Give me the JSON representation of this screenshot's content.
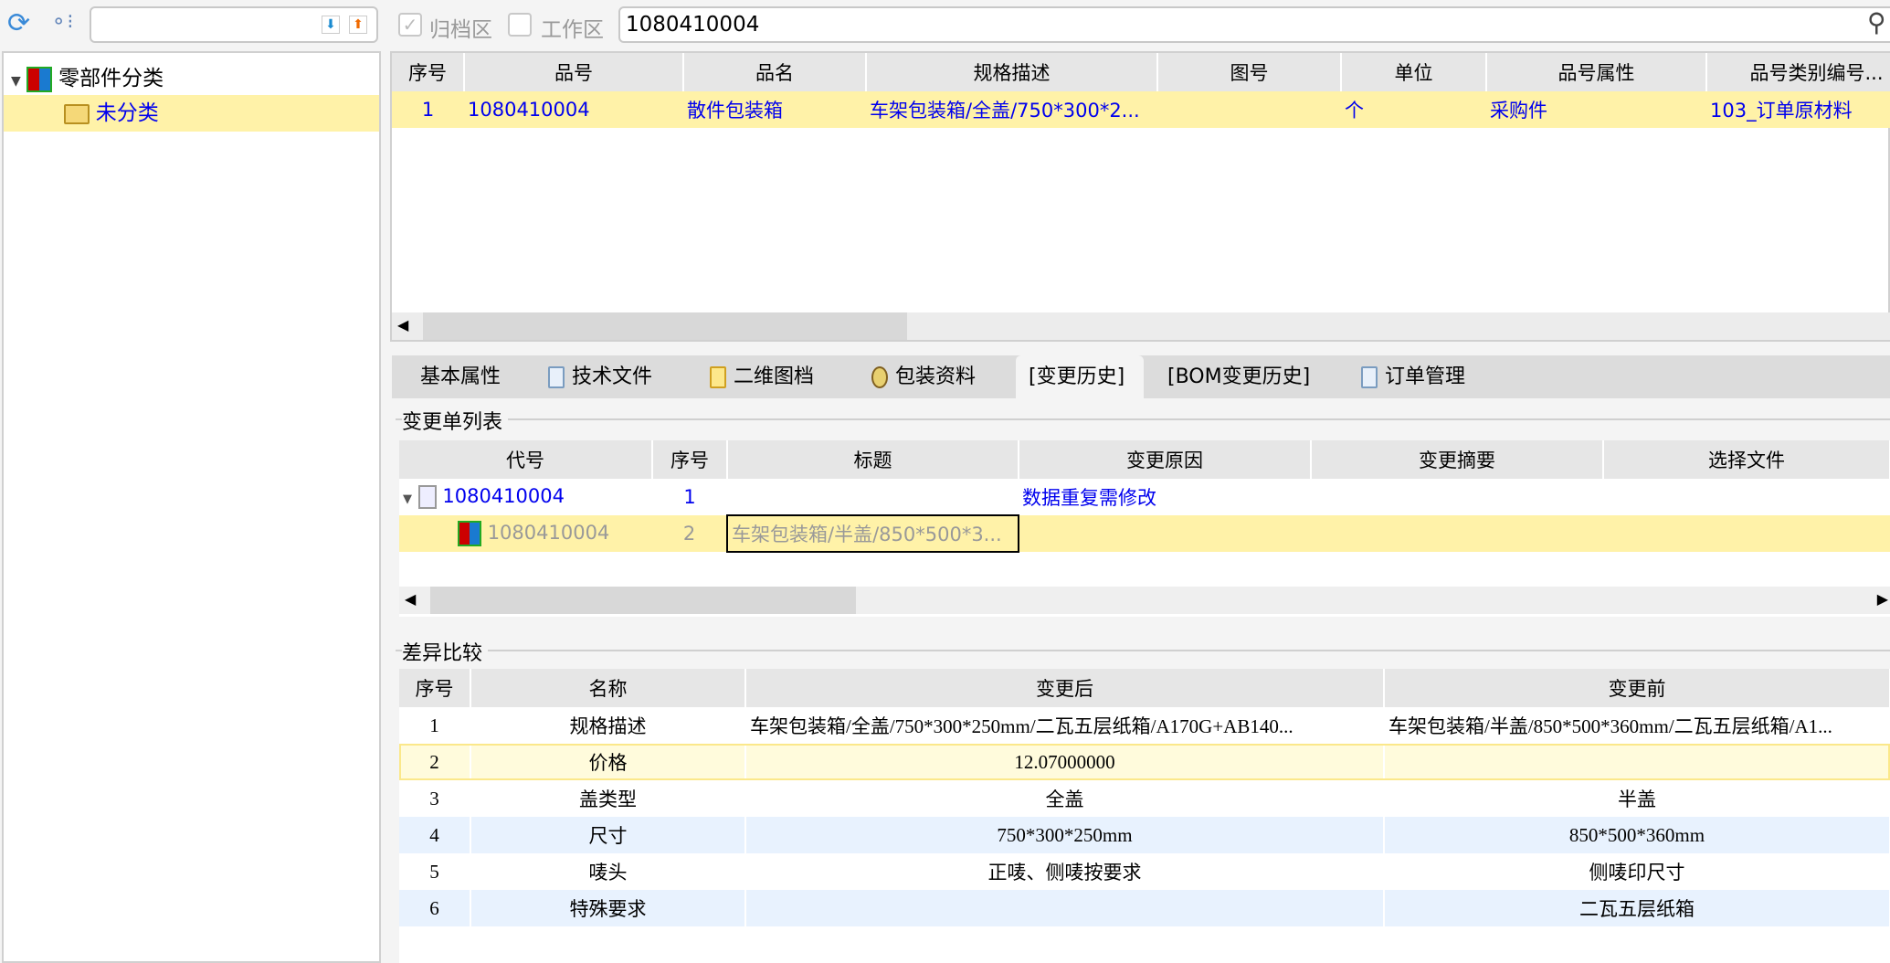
{
  "toolbar": {
    "search_value": "",
    "archive_label": "归档区",
    "work_label": "工作区",
    "archive_checked": true,
    "work_checked": false,
    "query_value": "1080410004"
  },
  "tree": {
    "root": "零部件分类",
    "child": "未分类"
  },
  "parts_table": {
    "headers": [
      "序号",
      "品号",
      "品名",
      "规格描述",
      "图号",
      "单位",
      "品号属性",
      "品号类别编号..."
    ],
    "rows": [
      [
        "1",
        "1080410004",
        "散件包装箱",
        "车架包装箱/全盖/750*300*2...",
        "",
        "个",
        "采购件",
        "103_订单原材料"
      ]
    ]
  },
  "tabs": [
    "基本属性",
    "技术文件",
    "二维图档",
    "包装资料",
    "[变更历史]",
    "[BOM变更历史]",
    "订单管理"
  ],
  "active_tab": "[变更历史]",
  "change_list": {
    "legend": "变更单列表",
    "headers": [
      "代号",
      "序号",
      "标题",
      "变更原因",
      "变更摘要",
      "选择文件"
    ],
    "rows": [
      [
        "1080410004",
        "1",
        "",
        "数据重复需修改",
        "",
        ""
      ],
      [
        "1080410004",
        "2",
        "车架包装箱/半盖/850*500*3...",
        "",
        "",
        ""
      ]
    ]
  },
  "diff": {
    "legend": "差异比较",
    "headers": [
      "序号",
      "名称",
      "变更后",
      "变更前"
    ],
    "rows": [
      [
        "1",
        "规格描述",
        "车架包装箱/全盖/750*300*250mm/二瓦五层纸箱/A170G+AB140...",
        "车架包装箱/半盖/850*500*360mm/二瓦五层纸箱/A1..."
      ],
      [
        "2",
        "价格",
        "12.07000000",
        ""
      ],
      [
        "3",
        "盖类型",
        "全盖",
        "半盖"
      ],
      [
        "4",
        "尺寸",
        "750*300*250mm",
        "850*500*360mm"
      ],
      [
        "5",
        "唛头",
        "正唛、侧唛按要求",
        "侧唛印尺寸"
      ],
      [
        "6",
        "特殊要求",
        "",
        "二瓦五层纸箱"
      ]
    ]
  }
}
